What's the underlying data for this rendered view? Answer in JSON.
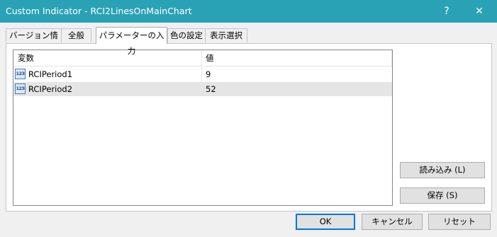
{
  "window": {
    "title": "Custom Indicator - RCI2LinesOnMainChart",
    "help_label": "?",
    "close_label": "✕"
  },
  "tabs": [
    {
      "label": "バージョン情報"
    },
    {
      "label": "全般"
    },
    {
      "label": "パラメーターの入力"
    },
    {
      "label": "色の設定"
    },
    {
      "label": "表示選択"
    }
  ],
  "grid": {
    "headers": {
      "variable": "変数",
      "value": "値"
    },
    "icon_text": "123",
    "rows": [
      {
        "name": "RCIPeriod1",
        "value": "9"
      },
      {
        "name": "RCIPeriod2",
        "value": "52"
      }
    ]
  },
  "side_buttons": {
    "load": "読み込み (L)",
    "save": "保存 (S)"
  },
  "footer": {
    "ok": "OK",
    "cancel": "キャンセル",
    "reset": "リセット"
  },
  "colors": {
    "titlebar": "#2aa2b6",
    "selected_row": "#e5e5e5",
    "default_button_border": "#0078d7"
  }
}
